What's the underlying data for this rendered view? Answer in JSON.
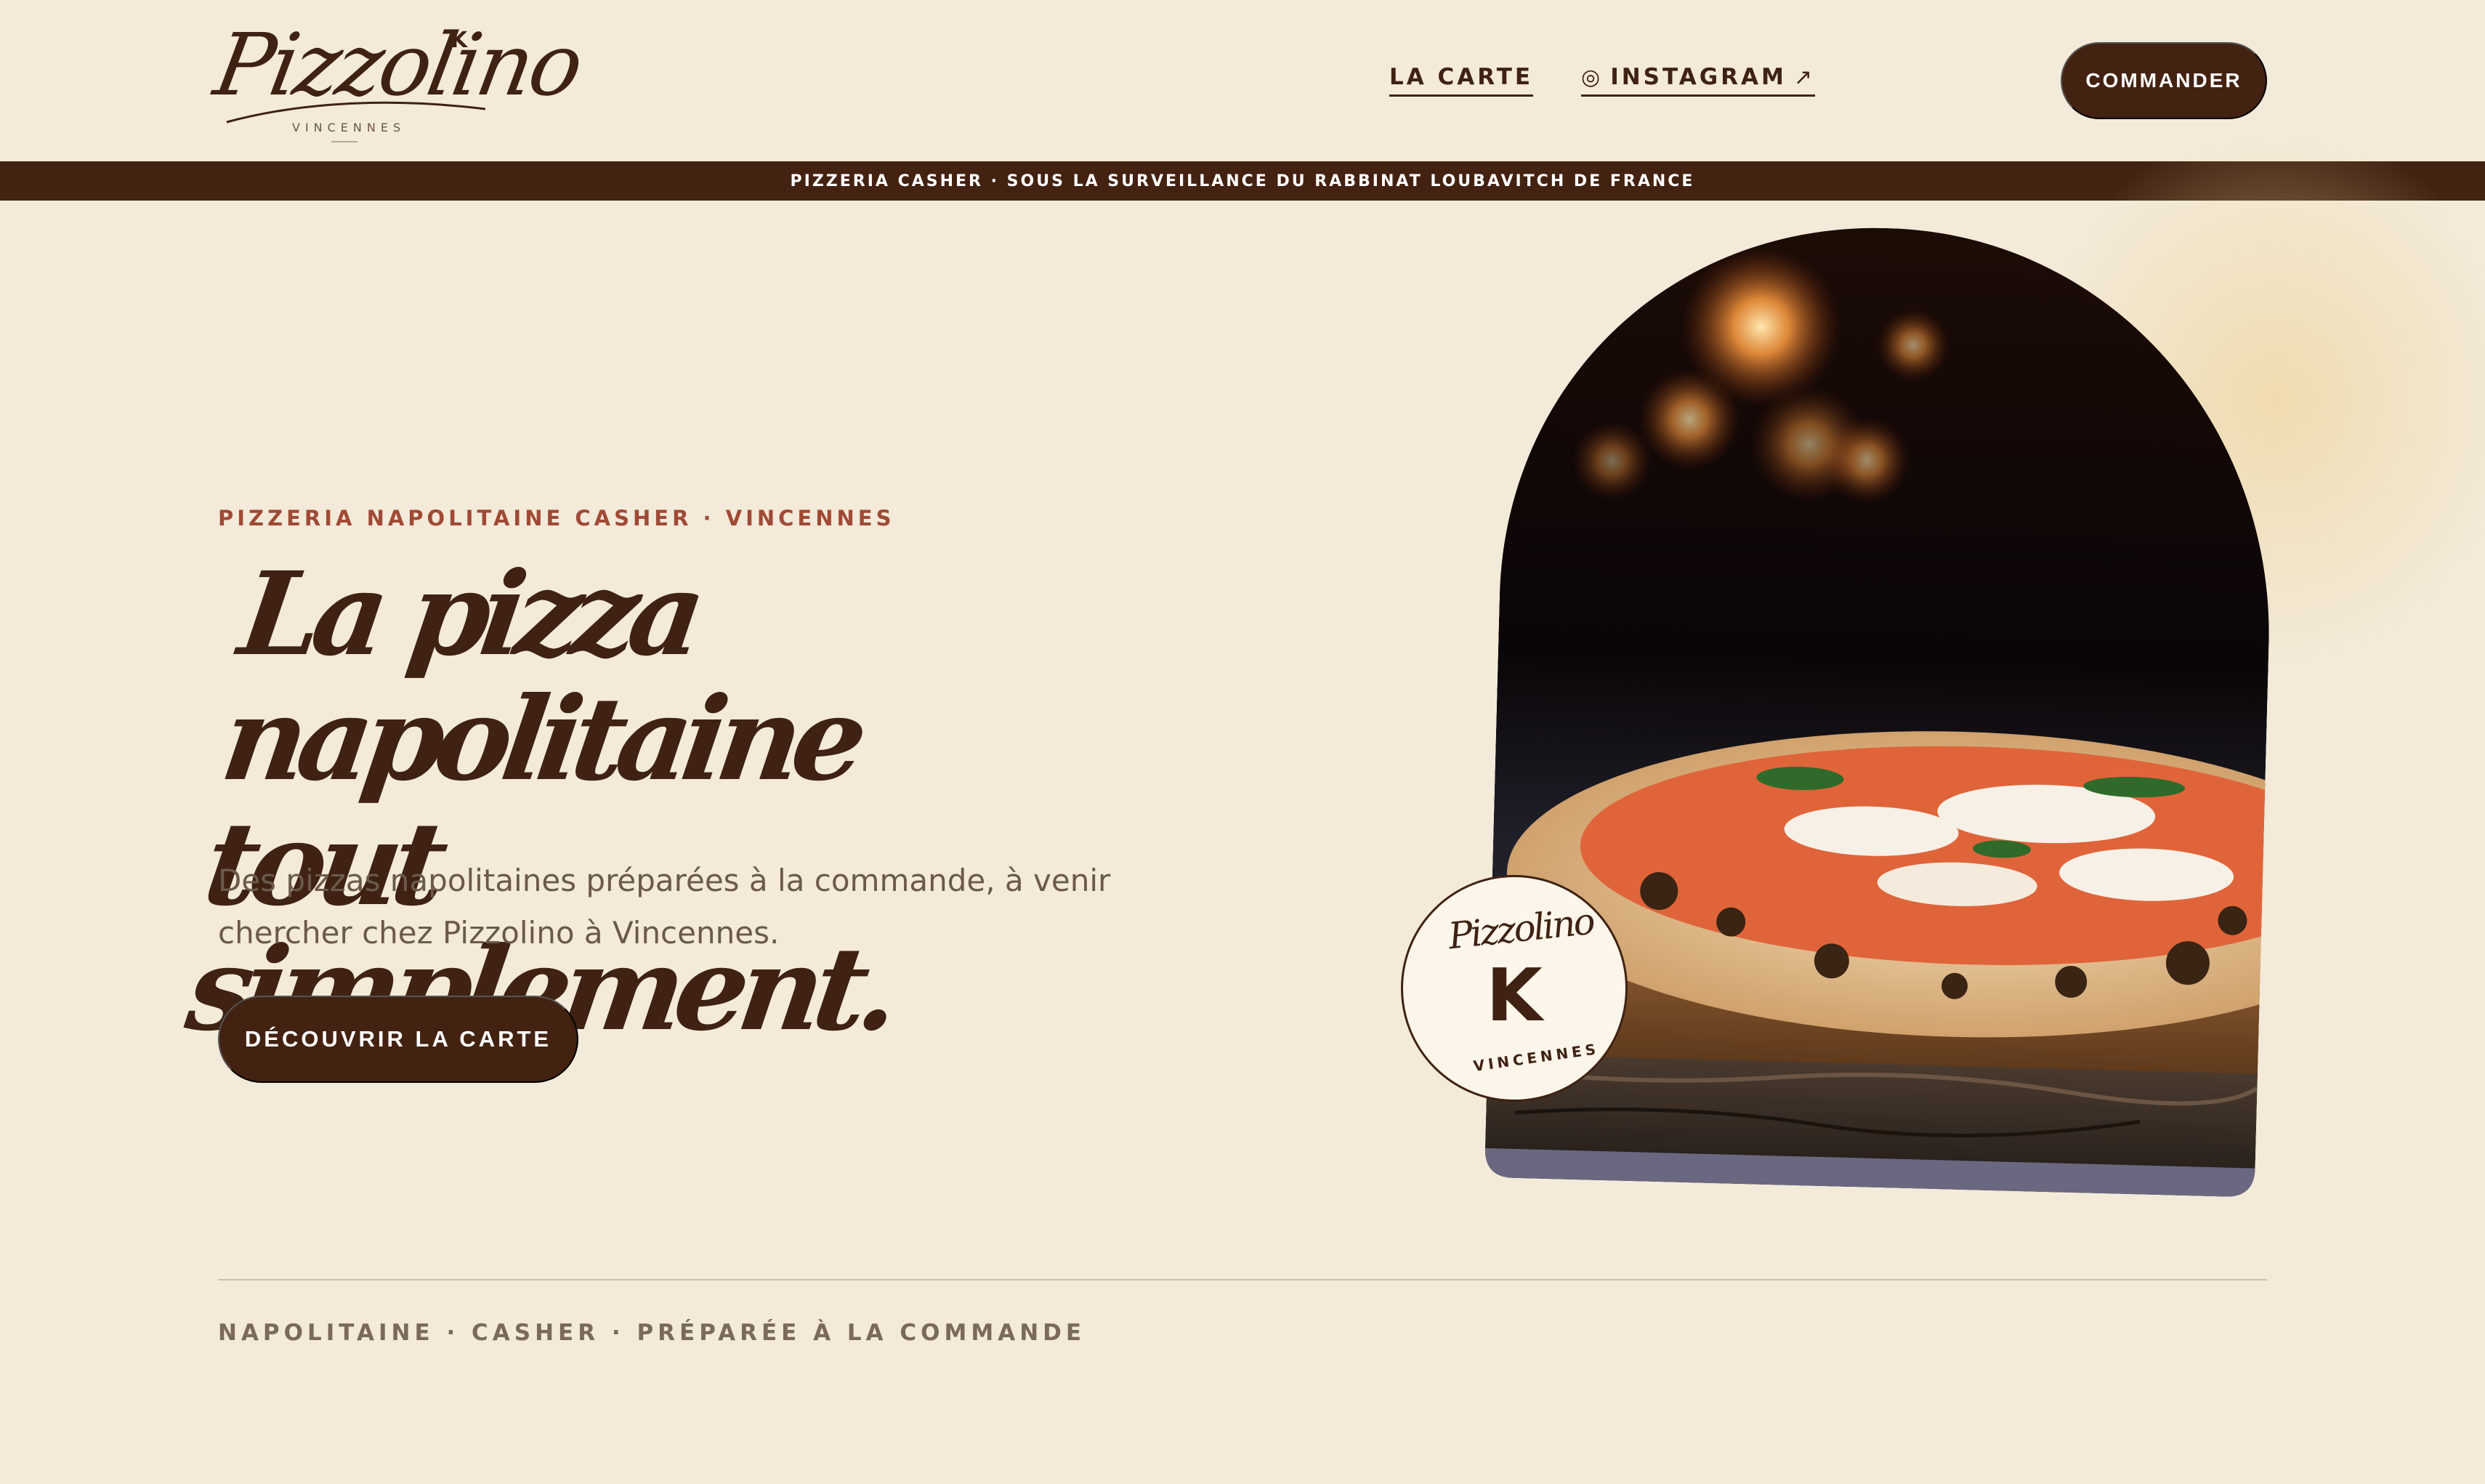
{
  "header": {
    "logo": {
      "script": "Pizzolino",
      "mark": "K",
      "subtitle": "VINCENNES"
    },
    "nav": [
      {
        "label": "LA CARTE"
      },
      {
        "icon": "instagram-icon",
        "glyph": "◎",
        "label": "INSTAGRAM",
        "arrow": "↗"
      }
    ],
    "cta_label": "COMMANDER"
  },
  "kosher_bar": "PIZZERIA CASHER · SOUS LA SURVEILLANCE DU RABBINAT LOUBAVITCH DE FRANCE",
  "hero": {
    "eyebrow": "PIZZERIA NAPOLITAINE CASHER · VINCENNES",
    "title_line1": "La pizza napolitaine",
    "title_line2": "tout simplement.",
    "description": "Des pizzas napolitaines préparées à la commande, à venir chercher chez Pizzolino à Vincennes.",
    "cta_label": "DÉCOUVRIR LA CARTE",
    "image_alt": "pizza-photo",
    "badge": {
      "script": "Pizzolino",
      "mark": "K",
      "subtitle": "VINCENNES"
    }
  },
  "tagline": "NAPOLITAINE · CASHER · PRÉPARÉE À LA COMMANDE",
  "colors": {
    "background": "#f3ead9",
    "brand_brown": "#432212",
    "accent_red": "#a04a36"
  }
}
